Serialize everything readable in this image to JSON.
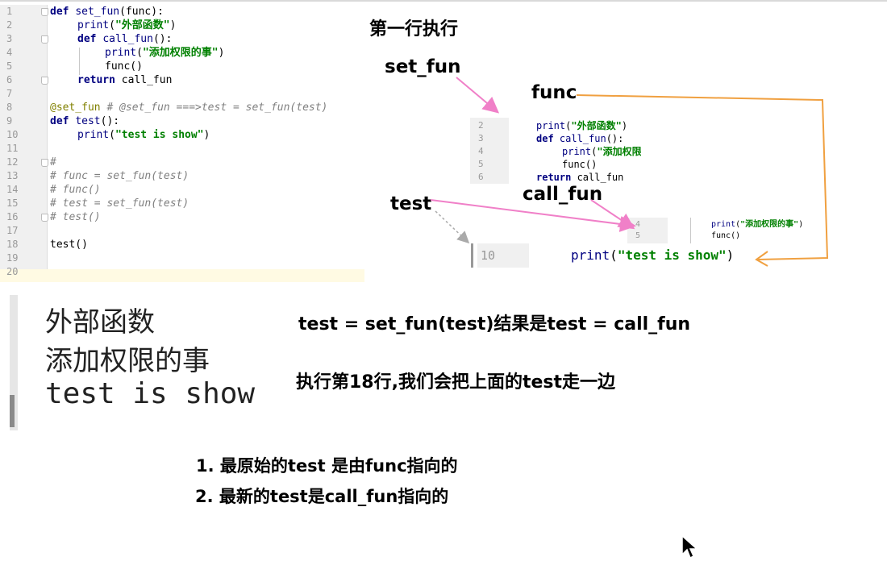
{
  "editor": {
    "lines": [
      {
        "n": "1",
        "segs": [
          {
            "t": "def ",
            "c": "kw"
          },
          {
            "t": "set_fun",
            "c": "fn"
          },
          {
            "t": "(func):",
            "c": "nm"
          }
        ],
        "indent": 0
      },
      {
        "n": "2",
        "segs": [
          {
            "t": "print",
            "c": "fn"
          },
          {
            "t": "(",
            "c": "nm"
          },
          {
            "t": "\"外部函数\"",
            "c": "str"
          },
          {
            "t": ")",
            "c": "nm"
          }
        ],
        "indent": 1
      },
      {
        "n": "3",
        "segs": [
          {
            "t": "def ",
            "c": "kw"
          },
          {
            "t": "call_fun",
            "c": "fn"
          },
          {
            "t": "():",
            "c": "nm"
          }
        ],
        "indent": 1
      },
      {
        "n": "4",
        "segs": [
          {
            "t": "print",
            "c": "fn"
          },
          {
            "t": "(",
            "c": "nm"
          },
          {
            "t": "\"添加权限的事\"",
            "c": "str"
          },
          {
            "t": ")",
            "c": "nm"
          }
        ],
        "indent": 2
      },
      {
        "n": "5",
        "segs": [
          {
            "t": "func()",
            "c": "nm"
          }
        ],
        "indent": 2
      },
      {
        "n": "6",
        "segs": [
          {
            "t": "return ",
            "c": "kw"
          },
          {
            "t": "call_fun",
            "c": "nm"
          }
        ],
        "indent": 1
      },
      {
        "n": "7",
        "segs": [],
        "indent": 0
      },
      {
        "n": "8",
        "segs": [
          {
            "t": "@set_fun",
            "c": "dec"
          },
          {
            "t": " # @set_fun ===>test = set_fun(test)",
            "c": "cm"
          }
        ],
        "indent": 0
      },
      {
        "n": "9",
        "segs": [
          {
            "t": "def ",
            "c": "kw"
          },
          {
            "t": "test",
            "c": "fn"
          },
          {
            "t": "():",
            "c": "nm"
          }
        ],
        "indent": 0
      },
      {
        "n": "10",
        "segs": [
          {
            "t": "print",
            "c": "fn"
          },
          {
            "t": "(",
            "c": "nm"
          },
          {
            "t": "\"test is show\"",
            "c": "str"
          },
          {
            "t": ")",
            "c": "nm"
          }
        ],
        "indent": 1
      },
      {
        "n": "11",
        "segs": [],
        "indent": 0
      },
      {
        "n": "12",
        "segs": [
          {
            "t": "#",
            "c": "cm"
          }
        ],
        "indent": 0
      },
      {
        "n": "13",
        "segs": [
          {
            "t": "# func = set_fun(test)",
            "c": "cm"
          }
        ],
        "indent": 0
      },
      {
        "n": "14",
        "segs": [
          {
            "t": "# func()",
            "c": "cm"
          }
        ],
        "indent": 0
      },
      {
        "n": "15",
        "segs": [
          {
            "t": "# test = set_fun(test)",
            "c": "cm"
          }
        ],
        "indent": 0
      },
      {
        "n": "16",
        "segs": [
          {
            "t": "# test()",
            "c": "cm"
          }
        ],
        "indent": 0
      },
      {
        "n": "17",
        "segs": [],
        "indent": 0
      },
      {
        "n": "18",
        "segs": [
          {
            "t": "test()",
            "c": "nm"
          }
        ],
        "indent": 0
      },
      {
        "n": "19",
        "segs": [],
        "indent": 0
      },
      {
        "n": "20",
        "segs": [],
        "indent": 0
      }
    ]
  },
  "snippet1": {
    "lines": [
      {
        "n": "2",
        "segs": [
          {
            "t": "print",
            "c": "fn"
          },
          {
            "t": "(",
            "c": "nm"
          },
          {
            "t": "\"外部函数\"",
            "c": "str"
          },
          {
            "t": ")",
            "c": "nm"
          }
        ],
        "indent": 0
      },
      {
        "n": "3",
        "segs": [
          {
            "t": "def ",
            "c": "kw"
          },
          {
            "t": "call_fun",
            "c": "fn"
          },
          {
            "t": "():",
            "c": "nm"
          }
        ],
        "indent": 0
      },
      {
        "n": "4",
        "segs": [
          {
            "t": "print",
            "c": "fn"
          },
          {
            "t": "(",
            "c": "nm"
          },
          {
            "t": "\"添加权限的事\"",
            "c": "str"
          },
          {
            "t": ")",
            "c": "nm"
          }
        ],
        "indent": 1
      },
      {
        "n": "5",
        "segs": [
          {
            "t": "func()",
            "c": "nm"
          }
        ],
        "indent": 1
      },
      {
        "n": "6",
        "segs": [
          {
            "t": "return ",
            "c": "kw"
          },
          {
            "t": "call_fun",
            "c": "nm"
          }
        ],
        "indent": 0
      }
    ]
  },
  "snippet2": {
    "lines": [
      {
        "n": "4",
        "segs": [
          {
            "t": "print",
            "c": "fn"
          },
          {
            "t": "(",
            "c": "nm"
          },
          {
            "t": "\"添加权限的事\"",
            "c": "str"
          },
          {
            "t": ")",
            "c": "nm"
          }
        ]
      },
      {
        "n": "5",
        "segs": [
          {
            "t": "func()",
            "c": "nm"
          }
        ]
      }
    ]
  },
  "snippet3": {
    "n": "10",
    "segs": [
      {
        "t": "print",
        "c": "fn"
      },
      {
        "t": "(",
        "c": "nm"
      },
      {
        "t": "\"test is show\"",
        "c": "str"
      },
      {
        "t": ")",
        "c": "nm"
      }
    ]
  },
  "labels": {
    "first_line": "第一行执行",
    "set_fun": "set_fun",
    "func": "func",
    "test": "test",
    "call_fun": "call_fun",
    "result": "test = set_fun(test)结果是test = call_fun",
    "execute18": "执行第18行,我们会把上面的test走一边",
    "note1": "1. 最原始的test 是由func指向的",
    "note2": "2. 最新的test是call_fun指向的"
  },
  "console": {
    "lines": [
      "外部函数",
      "添加权限的事",
      "test is show"
    ]
  },
  "colors": {
    "pink_arrow": "#f080c8",
    "orange_line": "#f0a040",
    "gray_arrow": "#aaaaaa"
  }
}
